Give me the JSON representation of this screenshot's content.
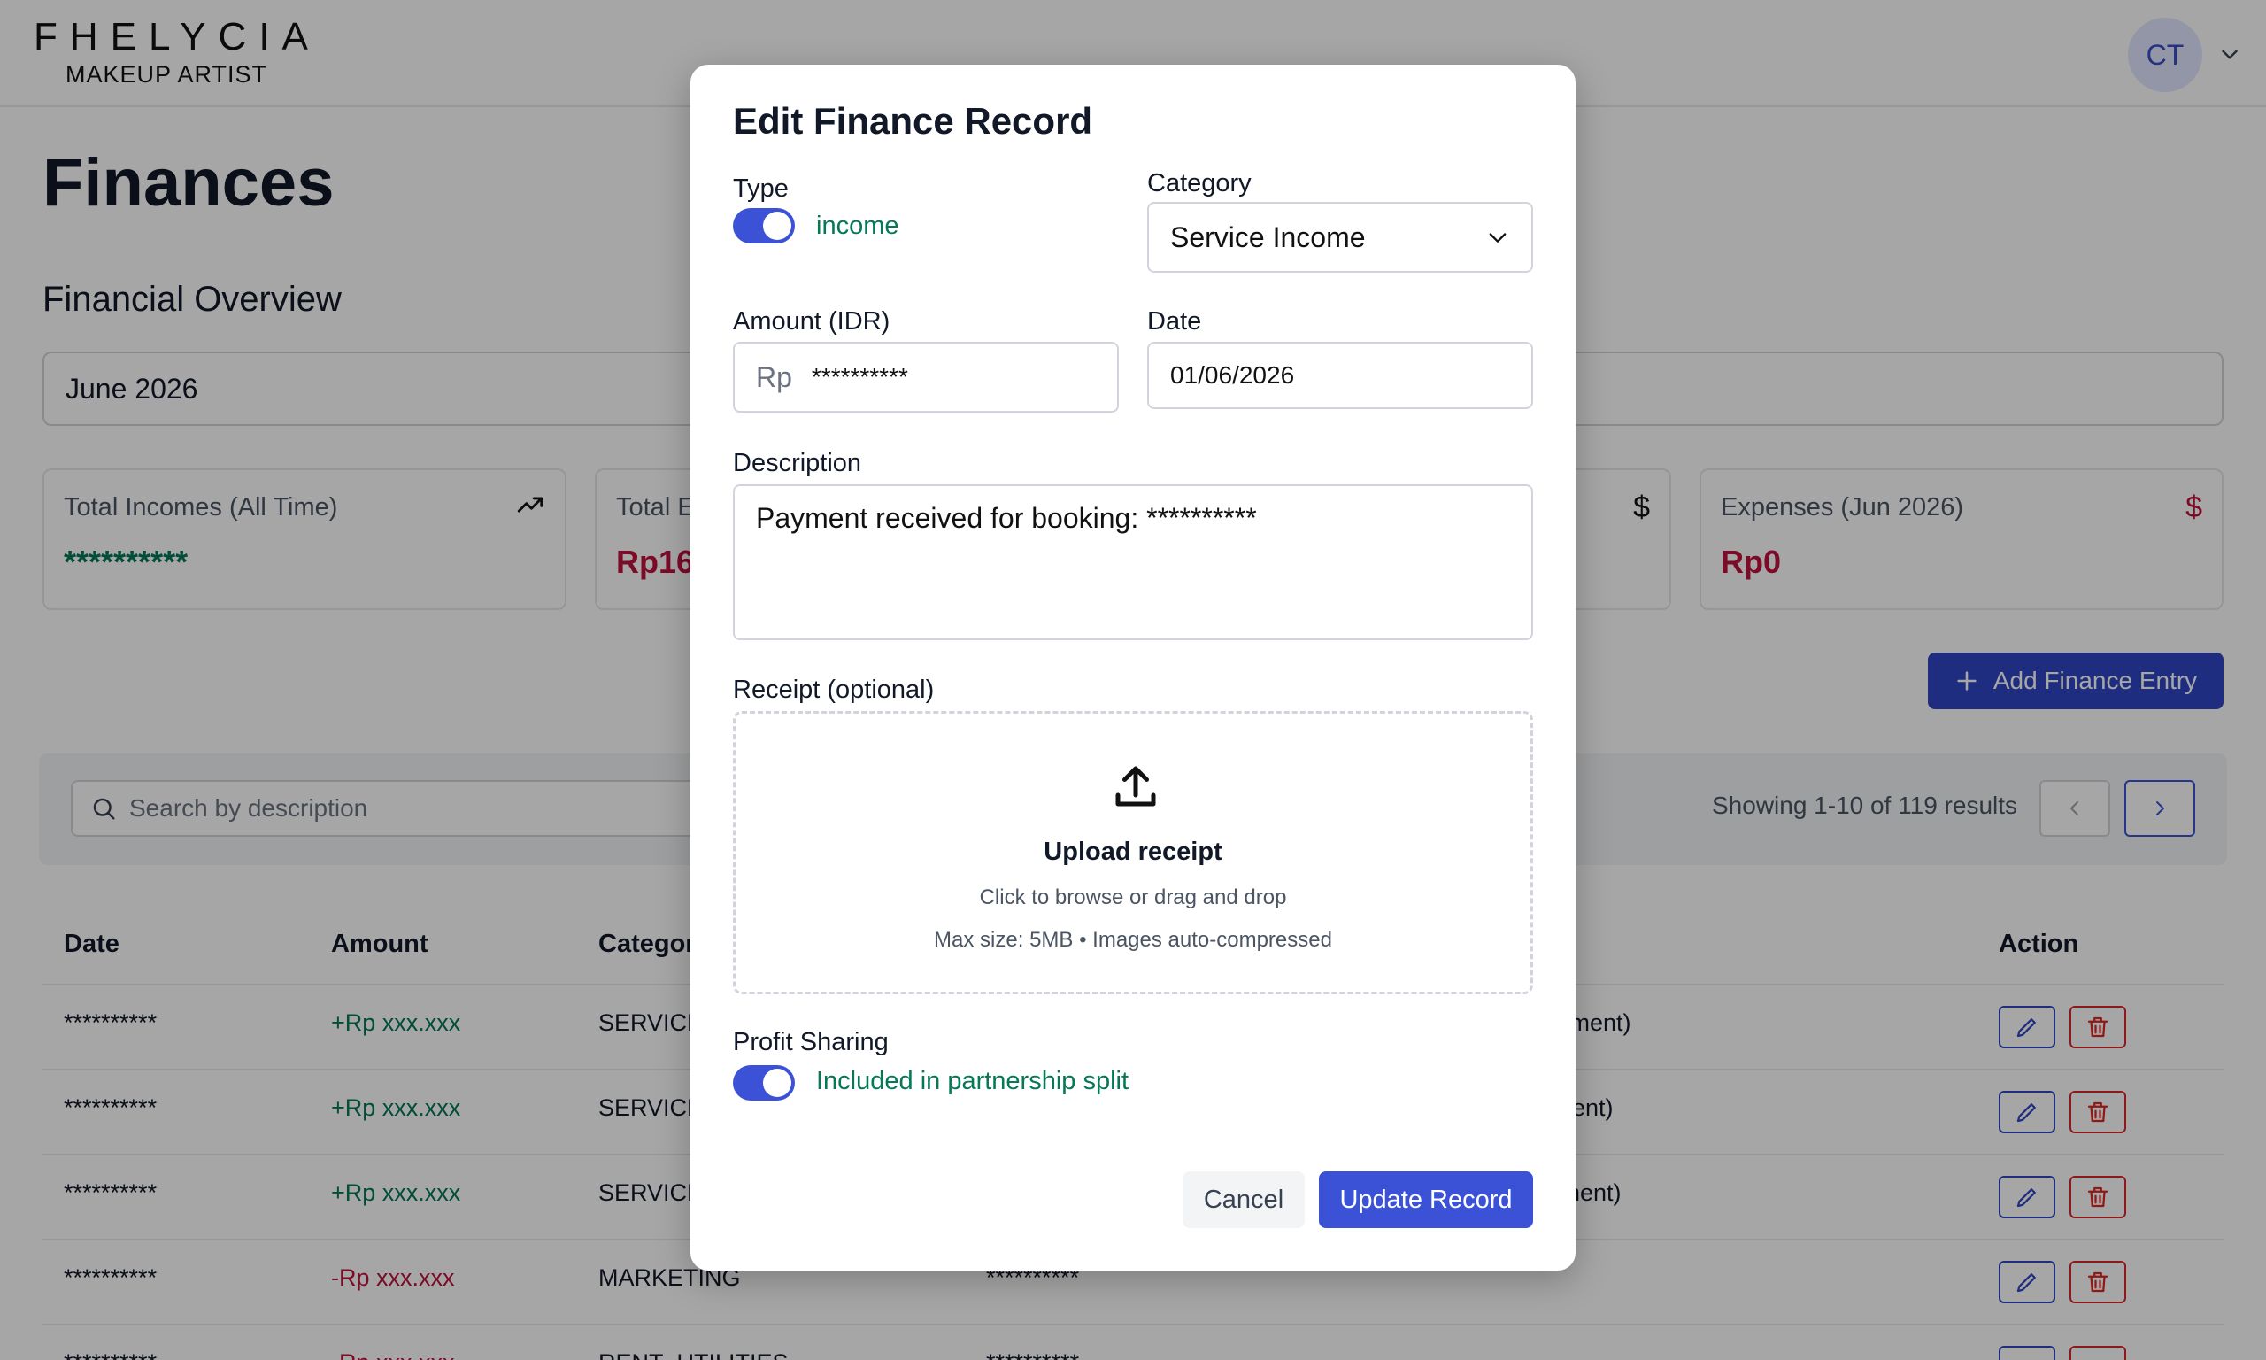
{
  "header": {
    "brand_name": "FHELYCIA",
    "brand_sub": "MAKEUP ARTIST",
    "avatar_initials": "CT"
  },
  "page": {
    "title": "Finances",
    "overview_title": "Financial Overview",
    "month": "June 2026"
  },
  "cards": [
    {
      "label": "Total Incomes (All Time)",
      "value": "**********",
      "icon": "trending-up-icon"
    },
    {
      "label": "Total E",
      "value": "Rp16"
    },
    {
      "label": "",
      "value": "",
      "icon": "dollar-icon"
    },
    {
      "label": "Expenses (Jun 2026)",
      "value": "Rp0",
      "icon": "dollar-icon"
    }
  ],
  "icons": {
    "dollar": "$"
  },
  "actions": {
    "add_entry": "Add Finance Entry"
  },
  "search": {
    "placeholder": "Search by description"
  },
  "pagination": {
    "showing": "Showing 1-10 of 119 results"
  },
  "table": {
    "columns": [
      "Date",
      "Amount",
      "Categor",
      "Action"
    ],
    "rows": [
      {
        "date": "**********",
        "amount": "+Rp xxx.xxx",
        "category": "SERVICE",
        "description": "yment)"
      },
      {
        "date": "**********",
        "amount": "+Rp xxx.xxx",
        "category": "SERVICE",
        "description": "ent)"
      },
      {
        "date": "**********",
        "amount": "+Rp xxx.xxx",
        "category": "SERVICE",
        "description": "nent)"
      },
      {
        "date": "**********",
        "amount": "-Rp xxx.xxx",
        "category": "MARKETING",
        "description": "**********"
      },
      {
        "date": "**********",
        "amount": "-Rp xxx.xxx",
        "category": "RENT_UTILITIES",
        "description": "**********"
      }
    ]
  },
  "modal": {
    "title": "Edit Finance Record",
    "type_label": "Type",
    "type_value": "income",
    "type_on": true,
    "category_label": "Category",
    "category_value": "Service Income",
    "amount_label": "Amount (IDR)",
    "amount_prefix": "Rp",
    "amount_value": "**********",
    "date_label": "Date",
    "date_value": "01/06/2026",
    "description_label": "Description",
    "description_value": "Payment received for booking: **********",
    "receipt_label": "Receipt (optional)",
    "upload_title": "Upload receipt",
    "upload_sub1": "Click to browse or drag and drop",
    "upload_sub2": "Max size: 5MB • Images auto-compressed",
    "profit_label": "Profit Sharing",
    "profit_value": "Included in partnership split",
    "profit_on": true,
    "cancel": "Cancel",
    "update": "Update Record"
  },
  "colors": {
    "accent": "#3b52d6",
    "income_green": "#047857",
    "expense_red": "#be123c"
  }
}
